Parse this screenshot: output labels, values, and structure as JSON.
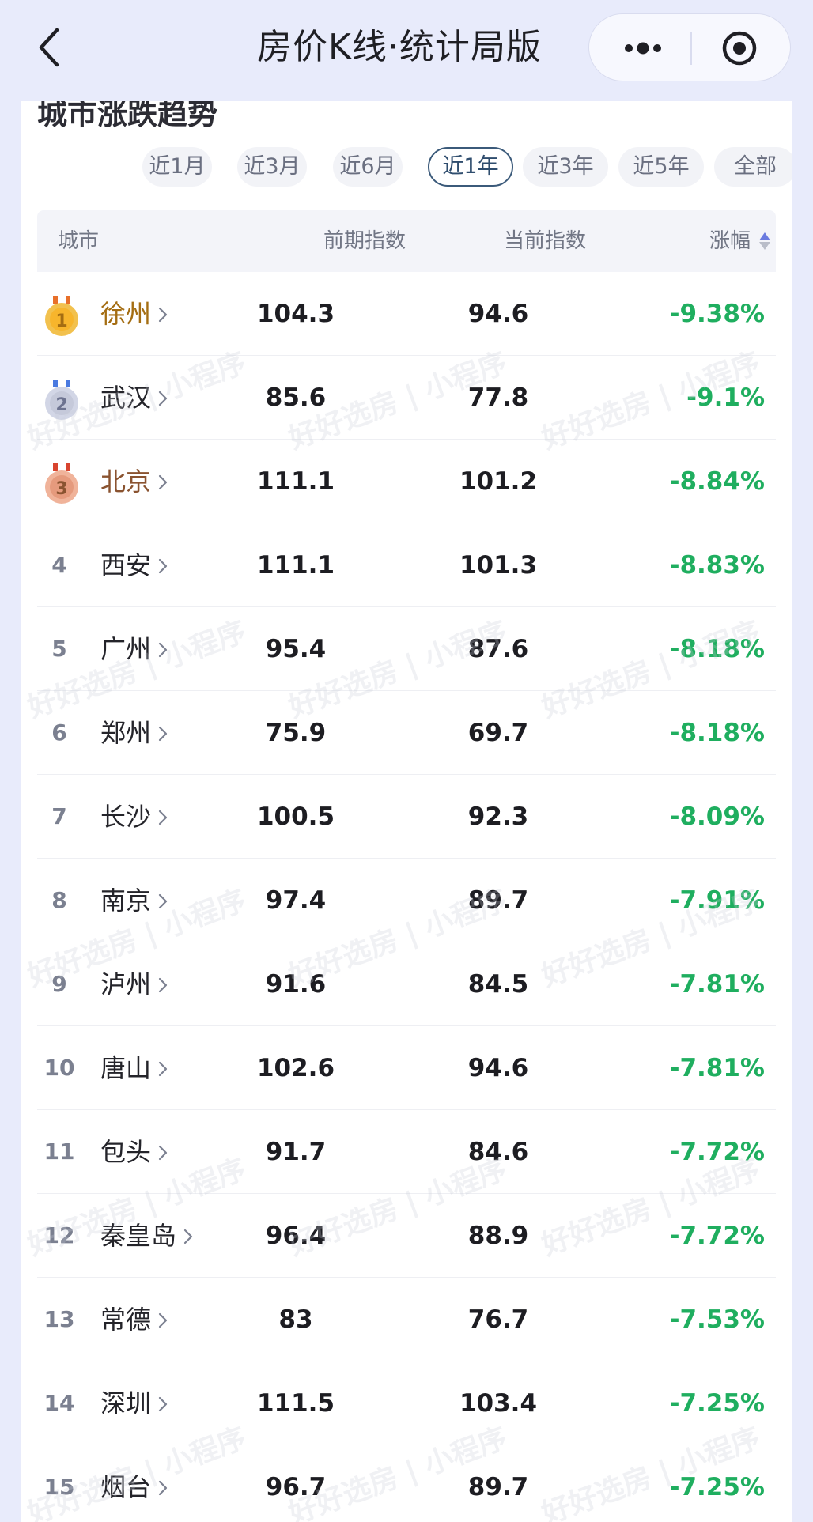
{
  "header": {
    "title": "房价K线·统计局版"
  },
  "section": {
    "title": "城市涨跌趋势"
  },
  "tabs": [
    {
      "label": "近1月",
      "active": false
    },
    {
      "label": "近3月",
      "active": false
    },
    {
      "label": "近6月",
      "active": false
    },
    {
      "label": "近1年",
      "active": true
    },
    {
      "label": "近3年",
      "active": false
    },
    {
      "label": "近5年",
      "active": false
    },
    {
      "label": "全部",
      "active": false
    }
  ],
  "table": {
    "columns": {
      "city": "城市",
      "prev": "前期指数",
      "curr": "当前指数",
      "change": "涨幅"
    },
    "rows": [
      {
        "rank": "1",
        "city": "徐州",
        "prev": "104.3",
        "curr": "94.6",
        "change": "-9.38%",
        "medal": "gold"
      },
      {
        "rank": "2",
        "city": "武汉",
        "prev": "85.6",
        "curr": "77.8",
        "change": "-9.1%",
        "medal": "silver"
      },
      {
        "rank": "3",
        "city": "北京",
        "prev": "111.1",
        "curr": "101.2",
        "change": "-8.84%",
        "medal": "bronze"
      },
      {
        "rank": "4",
        "city": "西安",
        "prev": "111.1",
        "curr": "101.3",
        "change": "-8.83%"
      },
      {
        "rank": "5",
        "city": "广州",
        "prev": "95.4",
        "curr": "87.6",
        "change": "-8.18%"
      },
      {
        "rank": "6",
        "city": "郑州",
        "prev": "75.9",
        "curr": "69.7",
        "change": "-8.18%"
      },
      {
        "rank": "7",
        "city": "长沙",
        "prev": "100.5",
        "curr": "92.3",
        "change": "-8.09%"
      },
      {
        "rank": "8",
        "city": "南京",
        "prev": "97.4",
        "curr": "89.7",
        "change": "-7.91%"
      },
      {
        "rank": "9",
        "city": "泸州",
        "prev": "91.6",
        "curr": "84.5",
        "change": "-7.81%"
      },
      {
        "rank": "10",
        "city": "唐山",
        "prev": "102.6",
        "curr": "94.6",
        "change": "-7.81%"
      },
      {
        "rank": "11",
        "city": "包头",
        "prev": "91.7",
        "curr": "84.6",
        "change": "-7.72%"
      },
      {
        "rank": "12",
        "city": "秦皇岛",
        "prev": "96.4",
        "curr": "88.9",
        "change": "-7.72%"
      },
      {
        "rank": "13",
        "city": "常德",
        "prev": "83",
        "curr": "76.7",
        "change": "-7.53%"
      },
      {
        "rank": "14",
        "city": "深圳",
        "prev": "111.5",
        "curr": "103.4",
        "change": "-7.25%"
      },
      {
        "rank": "15",
        "city": "烟台",
        "prev": "96.7",
        "curr": "89.7",
        "change": "-7.25%"
      }
    ]
  },
  "watermark": {
    "brand": "好好选房",
    "app": "小程序"
  },
  "colors": {
    "background": "#e8ebfb",
    "negative": "#1fae5f",
    "gold": "#a46d12",
    "bronze": "#8a5330",
    "active_tab_border": "#3b5a7a"
  },
  "icons": {
    "back": "chevron-left-icon",
    "more": "more-dots-icon",
    "close": "target-circle-icon",
    "sort": "sort-arrows-icon",
    "row": "chevron-right-icon"
  }
}
